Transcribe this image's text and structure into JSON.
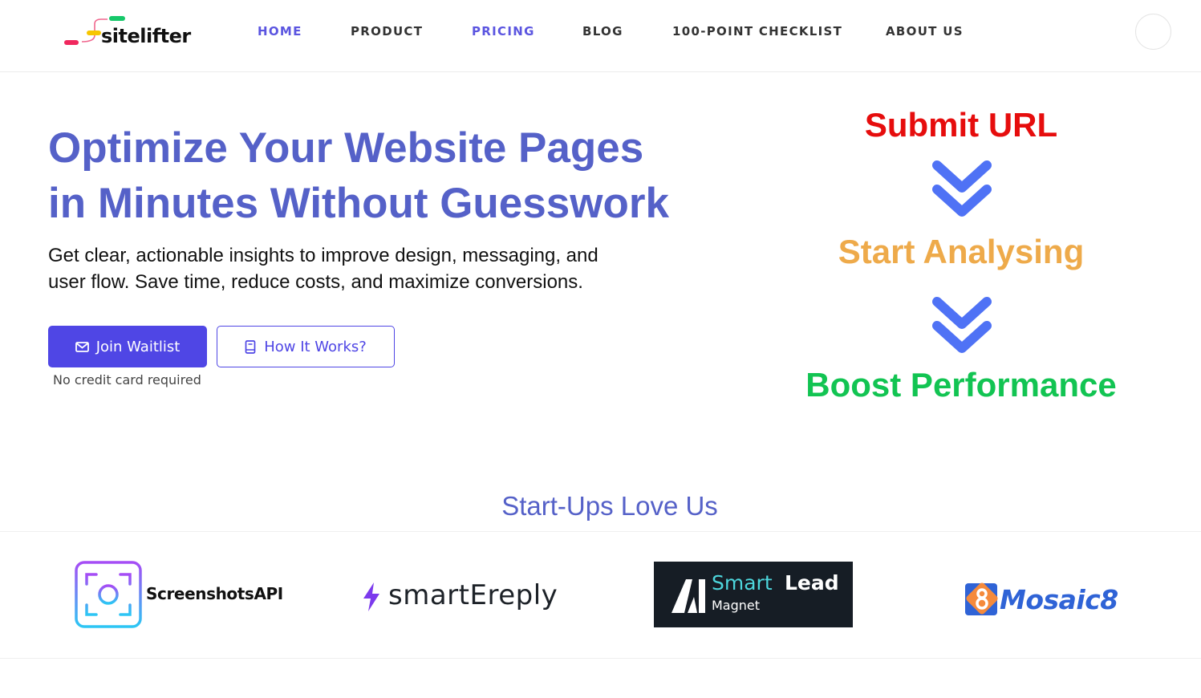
{
  "header": {
    "brand": "sitelifter",
    "nav": [
      {
        "label": "HOME",
        "active": true
      },
      {
        "label": "PRODUCT",
        "active": false
      },
      {
        "label": "PRICING",
        "active": true
      },
      {
        "label": "BLOG",
        "active": false
      },
      {
        "label": "100-POINT CHECKLIST",
        "active": false
      },
      {
        "label": "ABOUT US",
        "active": false
      }
    ]
  },
  "hero": {
    "title_line1": "Optimize Your Website Pages",
    "title_line2": "in Minutes Without Guesswork",
    "subtitle_line1": "Get clear, actionable insights to improve design, messaging, and",
    "subtitle_line2": "user flow. Save time, reduce costs, and maximize conversions.",
    "primary_button": {
      "label": "Join Waitlist",
      "icon": "mail-icon"
    },
    "secondary_button": {
      "label": "How It Works?",
      "icon": "book-icon"
    },
    "note": "No credit card required"
  },
  "steps": [
    {
      "label": "Submit URL",
      "color": "#e60d0d"
    },
    {
      "label": "Start Analysing",
      "color": "#eeaa4a"
    },
    {
      "label": "Boost Performance",
      "color": "#12c452"
    }
  ],
  "steps_arrow_icon": "double-chevron-down-icon",
  "startups": {
    "title": "Start-Ups Love Us",
    "logos": [
      {
        "name": "ScreenshotsAPI"
      },
      {
        "name": "smartEreply"
      },
      {
        "name_part1": "Smart",
        "name_part2": "Lead",
        "name_part3": "Magnet"
      },
      {
        "name": "Mosaic8"
      }
    ]
  },
  "colors": {
    "brand_primary": "#4f46e5",
    "heading": "#5561c8",
    "nav_active": "#5b55e0"
  }
}
